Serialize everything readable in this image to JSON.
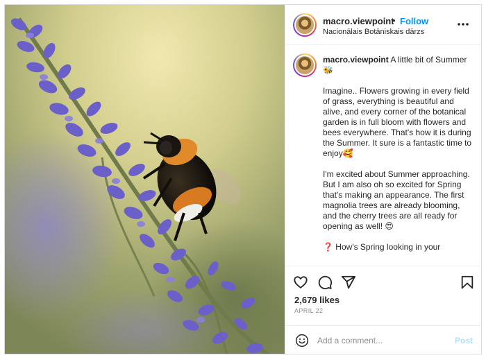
{
  "header": {
    "username": "macro.viewpoint",
    "separator": "•",
    "follow_label": "Follow",
    "location": "Nacionālais Botāniskais dārzs",
    "more_icon": "more-options-icon"
  },
  "caption": {
    "username": "macro.viewpoint",
    "lead": "A little bit of Summer 🐝",
    "paragraphs": [
      "Imagine.. Flowers growing in every field of grass, everything is beautiful and alive, and every corner of the botanical garden is in full bloom with flowers and bees everywhere. That's how it is during the Summer. It sure is a fantastic time to enjoy🥰",
      "I'm excited about Summer approaching. But I am also oh so excited for Spring that's making an appearance. The first magnolia trees are already blooming, and the cherry trees are all ready for opening as well! 😍",
      "❓ How's Spring looking in your"
    ]
  },
  "actions": {
    "icons": [
      "heart-icon",
      "comment-icon",
      "share-icon",
      "bookmark-icon"
    ],
    "likes": "2,679 likes",
    "date": "APRIL 22"
  },
  "comment": {
    "placeholder": "Add a comment...",
    "post_label": "Post",
    "emoji_icon": "smiley-icon"
  },
  "colors": {
    "link_blue": "#0095f6",
    "post_disabled": "#b2dffc",
    "border": "#dbdbdb",
    "muted": "#8e8e8e"
  }
}
